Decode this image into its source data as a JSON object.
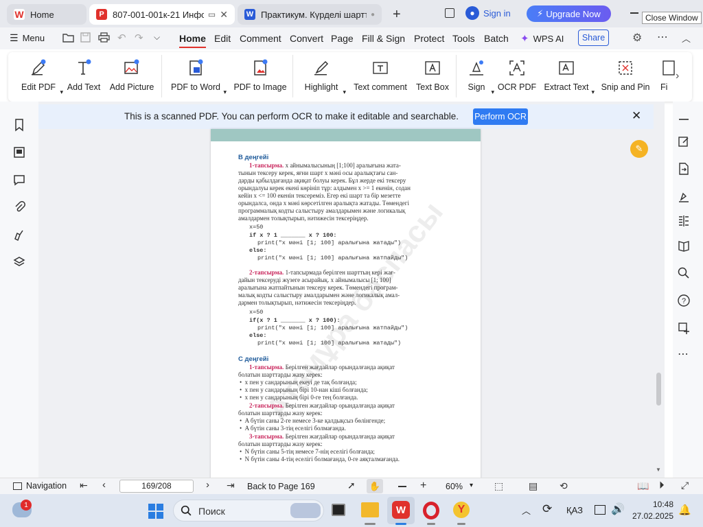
{
  "tabs": [
    {
      "label": "Home",
      "icon_color": "#e0312c"
    },
    {
      "label": "807-001-001к-21 Информ",
      "icon_color": "#e0312c"
    },
    {
      "label": "Практикум. Күрделі шартта",
      "icon_color": "#2a5bd7"
    }
  ],
  "window": {
    "sign_in": "Sign in",
    "upgrade": "Upgrade Now",
    "tooltip": "Close Window"
  },
  "menubar": {
    "menu": "Menu",
    "items": [
      "Home",
      "Edit",
      "Comment",
      "Convert",
      "Page",
      "Fill & Sign",
      "Protect",
      "Tools",
      "Batch"
    ],
    "wps_ai": "WPS AI",
    "share": "Share"
  },
  "ribbon": {
    "buttons": [
      "Edit PDF",
      "Add Text",
      "Add Picture",
      "PDF to Word",
      "PDF to Image",
      "Highlight",
      "Text comment",
      "Text Box",
      "Sign",
      "OCR PDF",
      "Extract Text",
      "Snip and Pin",
      "Fi"
    ]
  },
  "ocr": {
    "message": "This is a scanned PDF. You can perform OCR to make it editable and searchable.",
    "button": "Perform OCR"
  },
  "pdf": {
    "watermark": "Атамұра баспасы",
    "b_level": "В деңгейі",
    "t1_label": "1-тапсырма.",
    "t1_l1": " x айнымалысының [1;100] аралығына жата-",
    "t1_l2": "тынын тексеру керек, яғни шарт x мәні осы аралықтағы сан-",
    "t1_l3": "дарды қабылдағанда ақиқат болуы керек. Бұл жерде екі тексеру",
    "t1_l4": "орындалуы керек екені көрініп тұр: алдымен x >= 1 екенін, содан",
    "t1_l5": "кейін x <= 100 екенін тексереміз. Егер екі шарт та бір мезетте",
    "t1_l6": "орындалса, онда x мәні көрсетілген аралықта жатады. Төмендегі",
    "t1_l7": "программалық кодты салыстыру амалдарымен және логикалық",
    "t1_l8": "амалдармен толықтырып, нәтижесін тексеріңдер.",
    "c1_1": "x=50",
    "c1_2": "if x ? 1 _______ x ? 100:",
    "c1_3": "print(\"x мәні [1; 100] аралығына жатады\")",
    "c1_4": "else:",
    "c1_5": "print(\"x мәні [1; 100] аралығына жатпайды\")",
    "t2_label": "2-тапсырма.",
    "t2_l1": " 1-тапсырмада берілген шарттың кері жағ-",
    "t2_l2": "дайын тексеруді жүзеге асырайық. x айнымалысы [1; 100]",
    "t2_l3": "аралығына жатпайтынын тексеру керек. Төмендегі програм-",
    "t2_l4": "малық кодты салыстыру амалдарымен және логикалық амал-",
    "t2_l5": "дармен толықтырып, нәтижесін тексеріңдер.",
    "c2_1": "x=50",
    "c2_2": "if(x ? 1 _______ x ? 100):",
    "c2_3": "print(\"x мәні [1; 100] аралығына жатпайды\")",
    "c2_4": "else:",
    "c2_5": "print(\"x мәні [1; 100] аралығына жатады\")",
    "c_level": "С деңгейі",
    "s1_label": "1-тапсырма.",
    "s1_l1": " Берілген жағдайлар орындалғанда ақиқат",
    "s1_l2": "болатын шарттарды жазу керек:",
    "s1_b1": "x пен y сандарының екеуі де тақ болғанда;",
    "s1_b2": "x пен y сандарының бірі 10-нан кіші болғанда;",
    "s1_b3": "x пен y сандарының бірі 0-ге тең болғанда.",
    "s2_label": "2-тапсырма.",
    "s2_l1": " Берілген жағдайлар орындалғанда ақиқат",
    "s2_l2": "болатын шарттарды жазу керек:",
    "s2_b1": "A бүтін саны 2-ге немесе 3-ке қалдықсыз бөлінгенде;",
    "s2_b2": "A бүтін саны 3-тің еселігі болмағанда.",
    "s3_label": "3-тапсырма.",
    "s3_l1": " Берілген жағдайлар орындалғанда ақиқат",
    "s3_l2": "болатын шарттарды жазу керек:",
    "s3_b1": "N бүтін саны 5-тің немесе 7-нің еселігі болғанда;",
    "s3_b2": "N бүтін саны 4-тің еселігі болмағанда, 0-ге аяқталмағанда."
  },
  "status": {
    "navigation": "Navigation",
    "page": "169/208",
    "back": "Back to Page 169",
    "zoom": "60%"
  },
  "taskbar": {
    "search": "Поиск",
    "weather_badge": "1",
    "lang": "ҚАЗ",
    "time": "10:48",
    "date": "27.02.2025"
  }
}
